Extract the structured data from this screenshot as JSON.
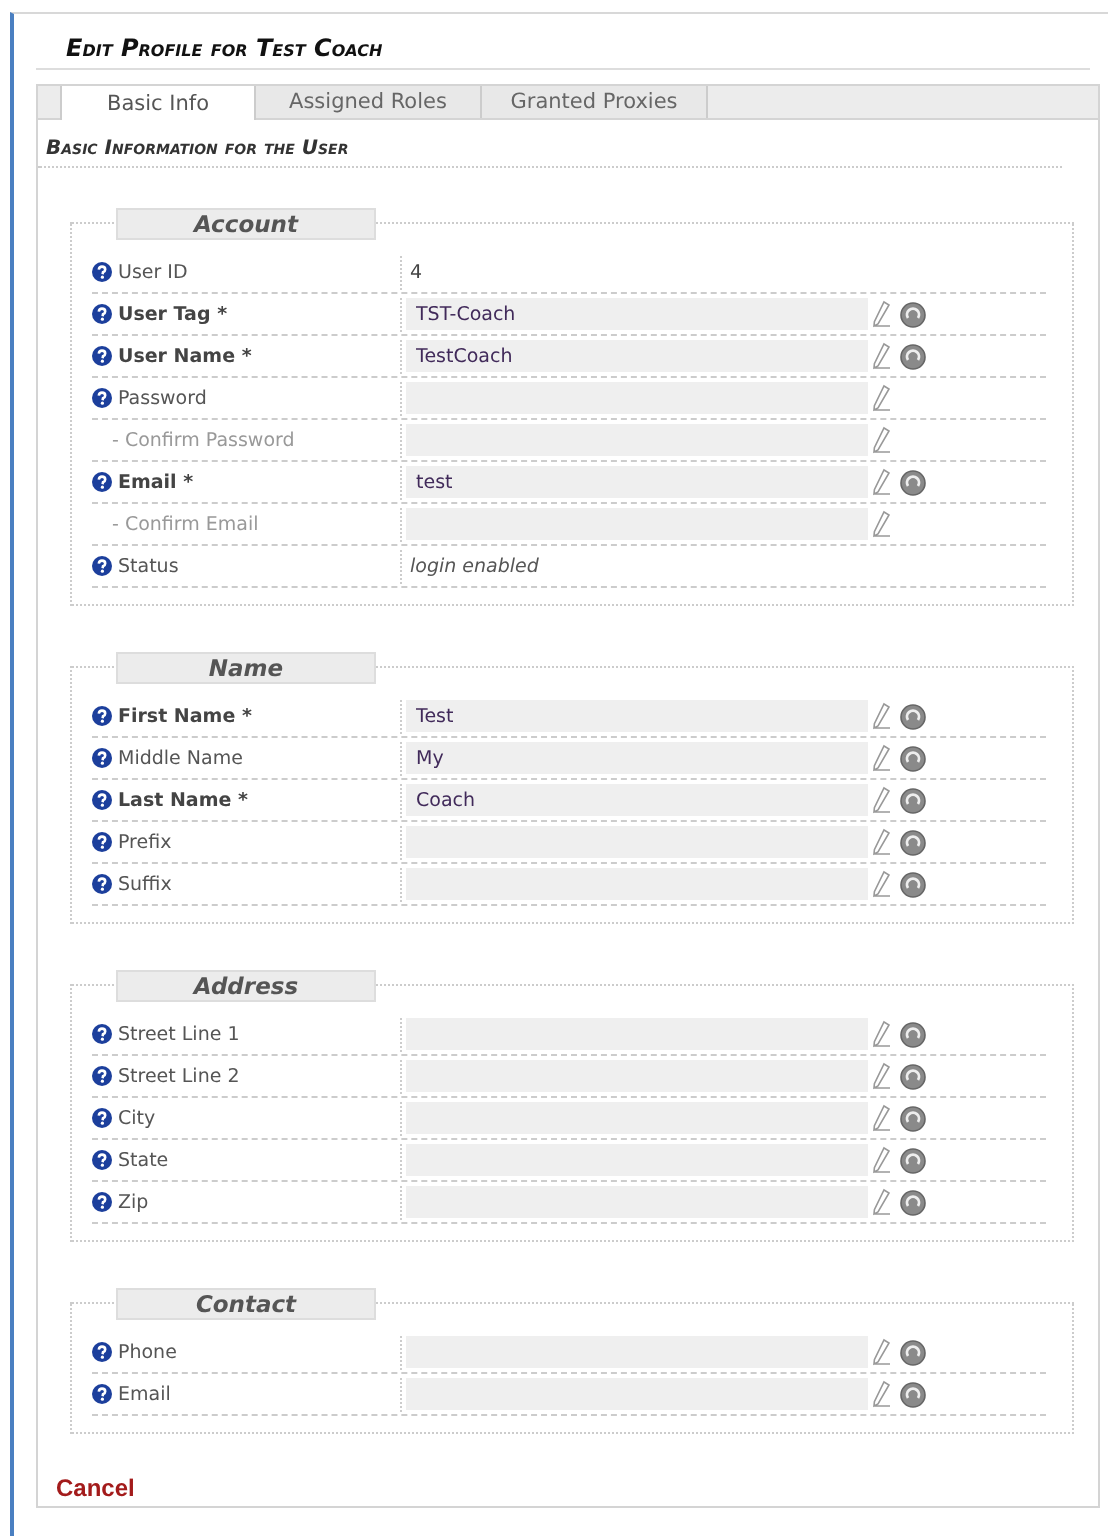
{
  "page": {
    "title": "Edit Profile for Test Coach"
  },
  "tabs": [
    {
      "label": "Basic Info",
      "selected": true
    },
    {
      "label": "Assigned Roles",
      "selected": false
    },
    {
      "label": "Granted Proxies",
      "selected": false
    }
  ],
  "subtitle": "Basic Information for the User",
  "sections": [
    {
      "legend": "Account",
      "fields": [
        {
          "label": "User ID",
          "kind": "text",
          "value": "4",
          "help": true,
          "required": false,
          "sub": false,
          "resettable": false
        },
        {
          "label": "User Tag *",
          "kind": "input",
          "value": "TST-Coach",
          "help": true,
          "required": true,
          "sub": false,
          "resettable": true
        },
        {
          "label": "User Name *",
          "kind": "input",
          "value": "TestCoach",
          "help": true,
          "required": true,
          "sub": false,
          "resettable": true
        },
        {
          "label": "Password",
          "kind": "input",
          "help": true,
          "required": false,
          "sub": false,
          "resettable": false
        },
        {
          "label": "- Confirm Password",
          "kind": "input",
          "help": false,
          "required": false,
          "sub": true,
          "resettable": false
        },
        {
          "label": "Email *",
          "kind": "input",
          "value": "test",
          "help": true,
          "required": true,
          "sub": false,
          "resettable": true
        },
        {
          "label": "- Confirm Email",
          "kind": "input",
          "help": false,
          "required": false,
          "sub": true,
          "resettable": false
        },
        {
          "label": "Status",
          "kind": "note",
          "value": "login enabled",
          "help": true,
          "required": false,
          "sub": false,
          "resettable": false
        }
      ]
    },
    {
      "legend": "Name",
      "fields": [
        {
          "label": "First Name *",
          "kind": "input",
          "value": "Test",
          "help": true,
          "required": true,
          "sub": false,
          "resettable": true
        },
        {
          "label": "Middle Name",
          "kind": "input",
          "value": "My",
          "help": true,
          "required": false,
          "sub": false,
          "resettable": true
        },
        {
          "label": "Last Name *",
          "kind": "input",
          "value": "Coach",
          "help": true,
          "required": true,
          "sub": false,
          "resettable": true
        },
        {
          "label": "Prefix",
          "kind": "input",
          "help": true,
          "required": false,
          "sub": false,
          "resettable": true
        },
        {
          "label": "Suffix",
          "kind": "input",
          "help": true,
          "required": false,
          "sub": false,
          "resettable": true
        }
      ]
    },
    {
      "legend": "Address",
      "fields": [
        {
          "label": "Street Line 1",
          "kind": "input",
          "help": true,
          "required": false,
          "sub": false,
          "resettable": true
        },
        {
          "label": "Street Line 2",
          "kind": "input",
          "help": true,
          "required": false,
          "sub": false,
          "resettable": true
        },
        {
          "label": "City",
          "kind": "input",
          "help": true,
          "required": false,
          "sub": false,
          "resettable": true
        },
        {
          "label": "State",
          "kind": "input",
          "help": true,
          "required": false,
          "sub": false,
          "resettable": true
        },
        {
          "label": "Zip",
          "kind": "input",
          "help": true,
          "required": false,
          "sub": false,
          "resettable": true
        }
      ]
    },
    {
      "legend": "Contact",
      "fields": [
        {
          "label": "Phone",
          "kind": "input",
          "help": true,
          "required": false,
          "sub": false,
          "resettable": true
        },
        {
          "label": "Email",
          "kind": "input",
          "help": true,
          "required": false,
          "sub": false,
          "resettable": true
        }
      ]
    }
  ],
  "cancel": "Cancel"
}
